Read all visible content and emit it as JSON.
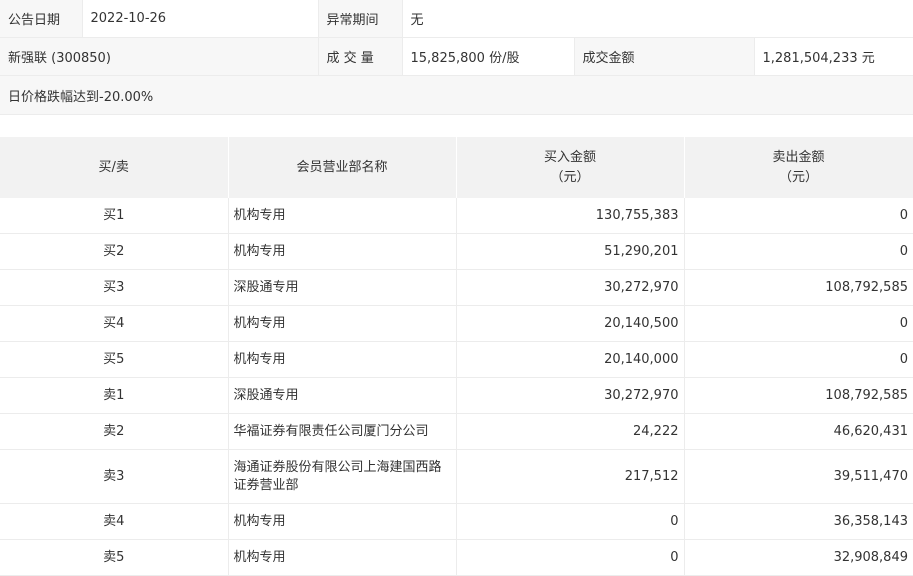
{
  "info": {
    "date_label": "公告日期",
    "date_value": "2022-10-26",
    "period_label": "异常期间",
    "period_value": "无",
    "stock": "新强联 (300850)",
    "volume_label": "成 交 量",
    "volume_value": "15,825,800 份/股",
    "amount_label": "成交金额",
    "amount_value": "1,281,504,233 元",
    "reason": "日价格跌幅达到-20.00%"
  },
  "table": {
    "headers": {
      "side": "买/卖",
      "branch": "会员营业部名称",
      "buy_line1": "买入金额",
      "buy_line2": "（元）",
      "sell_line1": "卖出金额",
      "sell_line2": "（元）"
    },
    "rows": [
      {
        "side": "买1",
        "branch": "机构专用",
        "buy": "130,755,383",
        "sell": "0"
      },
      {
        "side": "买2",
        "branch": "机构专用",
        "buy": "51,290,201",
        "sell": "0"
      },
      {
        "side": "买3",
        "branch": "深股通专用",
        "buy": "30,272,970",
        "sell": "108,792,585"
      },
      {
        "side": "买4",
        "branch": "机构专用",
        "buy": "20,140,500",
        "sell": "0"
      },
      {
        "side": "买5",
        "branch": "机构专用",
        "buy": "20,140,000",
        "sell": "0"
      },
      {
        "side": "卖1",
        "branch": "深股通专用",
        "buy": "30,272,970",
        "sell": "108,792,585"
      },
      {
        "side": "卖2",
        "branch": "华福证券有限责任公司厦门分公司",
        "buy": "24,222",
        "sell": "46,620,431"
      },
      {
        "side": "卖3",
        "branch": "海通证券股份有限公司上海建国西路证券营业部",
        "buy": "217,512",
        "sell": "39,511,470"
      },
      {
        "side": "卖4",
        "branch": "机构专用",
        "buy": "0",
        "sell": "36,358,143"
      },
      {
        "side": "卖5",
        "branch": "机构专用",
        "buy": "0",
        "sell": "32,908,849"
      }
    ]
  }
}
